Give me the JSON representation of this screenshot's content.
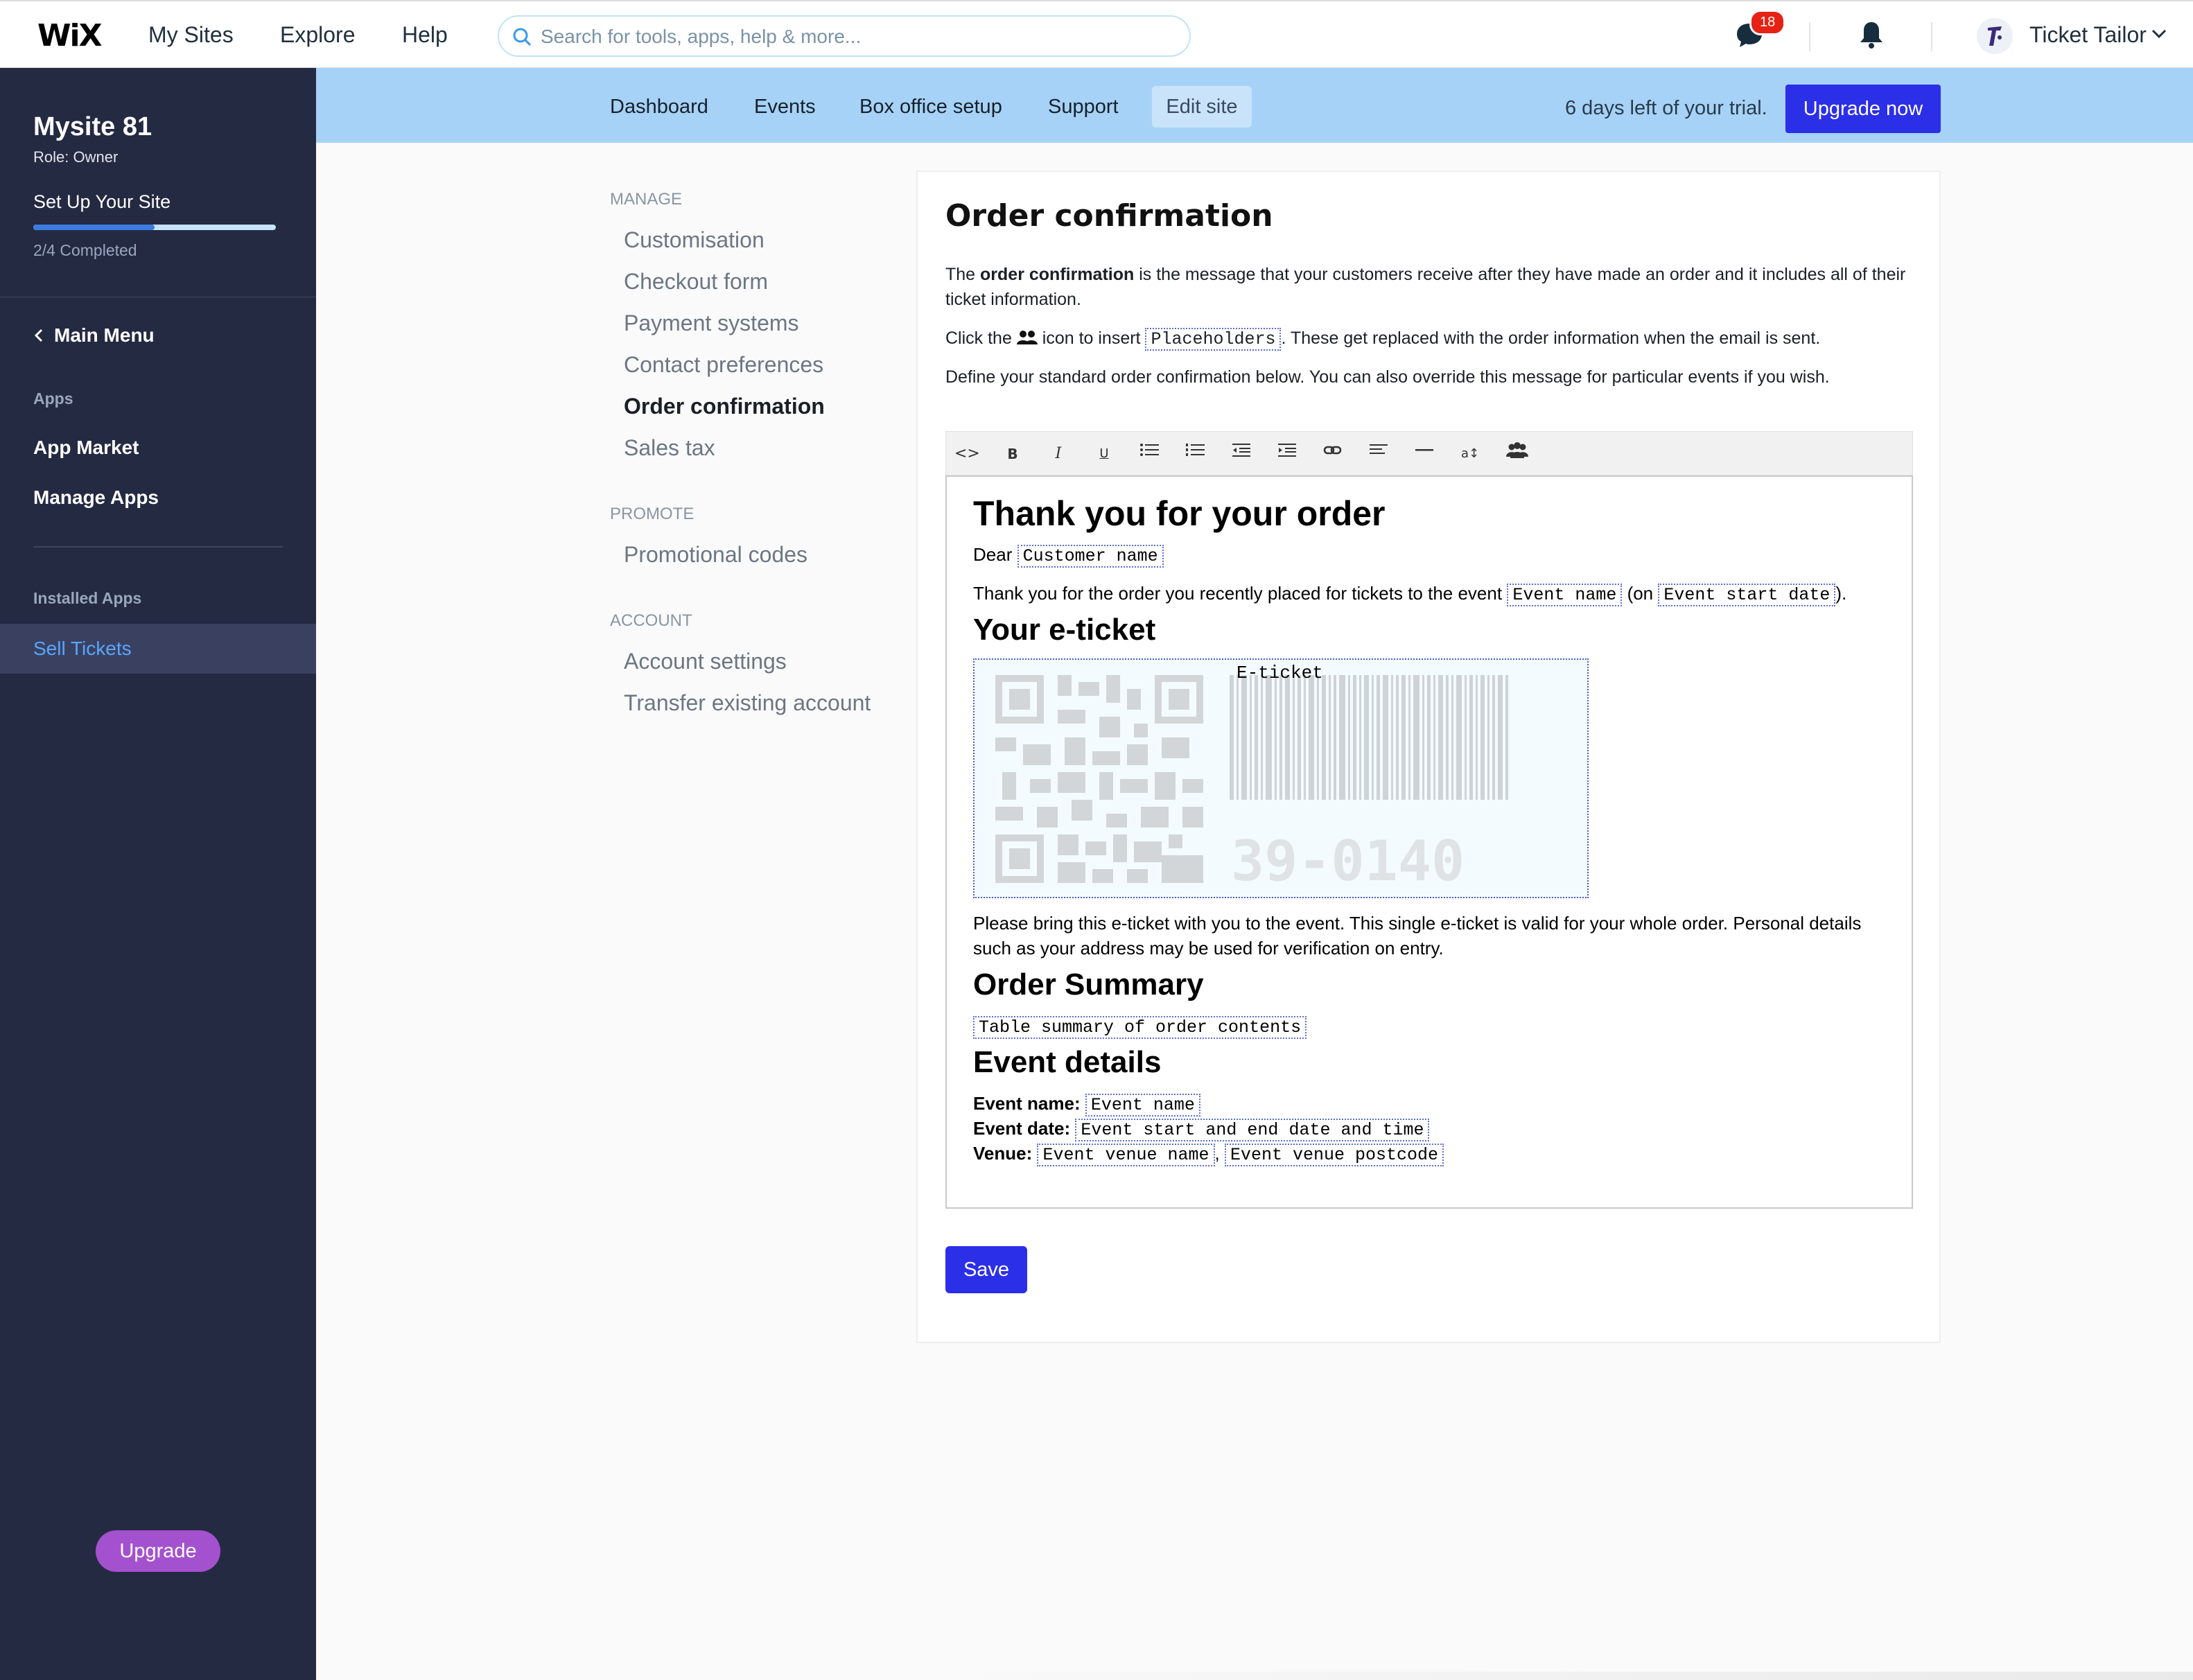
{
  "wix": {
    "logo": "WiX",
    "nav": [
      "My Sites",
      "Explore",
      "Help"
    ],
    "search_placeholder": "Search for tools, apps, help & more...",
    "notifications_count": "18",
    "user_name": "Ticket Tailor"
  },
  "sidebar": {
    "site_name": "Mysite 81",
    "role": "Role: Owner",
    "setup_label": "Set Up Your Site",
    "setup_progress": 0.5,
    "completed": "2/4 Completed",
    "main_menu": "Main Menu",
    "apps_heading": "Apps",
    "app_market": "App Market",
    "manage_apps": "Manage Apps",
    "installed_heading": "Installed Apps",
    "sell_tickets": "Sell Tickets",
    "upgrade": "Upgrade"
  },
  "tt_nav": {
    "items": [
      "Dashboard",
      "Events",
      "Box office setup",
      "Support",
      "Edit site"
    ],
    "trial_text": "6 days left of your trial.",
    "upgrade_now": "Upgrade now"
  },
  "settings_menu": {
    "manage_heading": "MANAGE",
    "manage_items": [
      "Customisation",
      "Checkout form",
      "Payment systems",
      "Contact preferences",
      "Order confirmation",
      "Sales tax"
    ],
    "promote_heading": "PROMOTE",
    "promote_items": [
      "Promotional codes"
    ],
    "account_heading": "ACCOUNT",
    "account_items": [
      "Account settings",
      "Transfer existing account"
    ]
  },
  "content": {
    "title": "Order confirmation",
    "intro_pre": "The ",
    "intro_bold": "order confirmation",
    "intro_post": " is the message that your customers receive after they have made an order and it includes all of their ticket information.",
    "click_pre": "Click the ",
    "click_mid": " icon to insert ",
    "placeholders": "Placeholders",
    "click_post": ". These get replaced with the order information when the email is sent.",
    "define": "Define your standard order confirmation below. You can also override this message for particular events if you wish.",
    "save": "Save"
  },
  "editor": {
    "heading": "Thank you for your order",
    "dear": "Dear ",
    "ph_customer_name": "Customer name",
    "thanks_pre": "Thank you for the order you recently placed for tickets to the event ",
    "ph_event_name": "Event name",
    "on_text": " (on ",
    "ph_event_start_date": "Event start date",
    "close_paren": ").",
    "eticket_heading": "Your e-ticket",
    "eticket_label": "E-ticket",
    "eticket_number": "39-0140",
    "bring_text": "Please bring this e-ticket with you to the event. This single e-ticket is valid for your whole order. Personal details such as your address may be used for verification on entry.",
    "summary_heading": "Order Summary",
    "ph_table_summary": "Table summary of order contents",
    "details_heading": "Event details",
    "event_name_label": "Event name:",
    "event_date_label": "Event date:",
    "ph_event_dates": "Event start and end date and time",
    "venue_label": "Venue:",
    "ph_venue_name": "Event venue name",
    "comma": ",",
    "ph_venue_postcode": "Event venue postcode"
  }
}
